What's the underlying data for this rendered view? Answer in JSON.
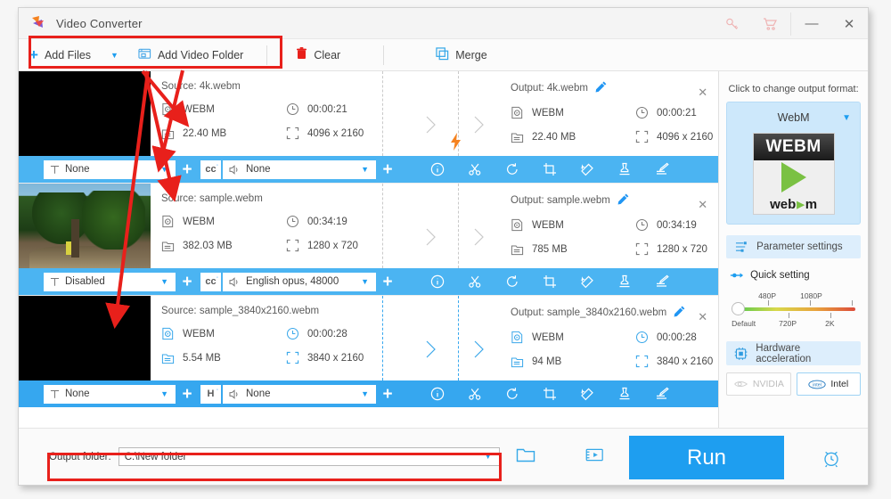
{
  "window": {
    "title": "Video Converter",
    "controls": {
      "key": "key-icon",
      "cart": "cart-icon",
      "minimize": "—",
      "close": "✕"
    }
  },
  "toolbar": {
    "add_files": "Add Files",
    "add_video_folder": "Add Video Folder",
    "clear": "Clear",
    "merge": "Merge"
  },
  "tasks": [
    {
      "source": {
        "title": "Source: 4k.webm",
        "format": "WEBM",
        "duration": "00:00:21",
        "size": "22.40 MB",
        "resolution": "4096 x 2160"
      },
      "output": {
        "title": "Output: 4k.webm",
        "format": "WEBM",
        "duration": "00:00:21",
        "size": "22.40 MB",
        "resolution": "4096 x 2160"
      },
      "subtitle": "None",
      "audio": "None",
      "cc_label": "cc",
      "selected": false,
      "has_bolt": true,
      "thumb": "black"
    },
    {
      "source": {
        "title": "Source: sample.webm",
        "format": "WEBM",
        "duration": "00:34:19",
        "size": "382.03 MB",
        "resolution": "1280 x 720"
      },
      "output": {
        "title": "Output: sample.webm",
        "format": "WEBM",
        "duration": "00:34:19",
        "size": "785 MB",
        "resolution": "1280 x 720"
      },
      "subtitle": "Disabled",
      "audio": "English opus, 48000",
      "cc_label": "cc",
      "selected": false,
      "has_bolt": false,
      "thumb": "forest"
    },
    {
      "source": {
        "title": "Source: sample_3840x2160.webm",
        "format": "WEBM",
        "duration": "00:00:28",
        "size": "5.54 MB",
        "resolution": "3840 x 2160"
      },
      "output": {
        "title": "Output: sample_3840x2160.webm",
        "format": "WEBM",
        "duration": "00:00:28",
        "size": "94 MB",
        "resolution": "3840 x 2160"
      },
      "subtitle": "None",
      "audio": "None",
      "cc_label": "H",
      "selected": true,
      "has_bolt": false,
      "thumb": "black"
    }
  ],
  "row_icons": [
    "info-icon",
    "cut-icon",
    "rotate-icon",
    "crop-icon",
    "effect-icon",
    "watermark-icon",
    "subtitle-icon"
  ],
  "sidebar": {
    "hint": "Click to change output format:",
    "format_name": "WebM",
    "logo_top": "WEBM",
    "logo_bottom_left": "web",
    "logo_bottom_right": "m",
    "parameter_settings": "Parameter settings",
    "quick_setting": "Quick setting",
    "slider_labels_top": [
      "480P",
      "1080P"
    ],
    "slider_labels_bottom": [
      "Default",
      "720P",
      "2K"
    ],
    "hardware_acceleration": "Hardware acceleration",
    "gpu_nvidia": "NVIDIA",
    "gpu_intel": "Intel"
  },
  "bottom": {
    "output_folder_label": "Output folder:",
    "output_folder_value": "C:\\New folder",
    "run_label": "Run"
  },
  "colors": {
    "accent": "#1e9ef0",
    "bluebar": "#4bb4f2",
    "bluebar_selected": "#36a7ef",
    "highlight": "#e8201b",
    "bolt": "#f5821f"
  }
}
